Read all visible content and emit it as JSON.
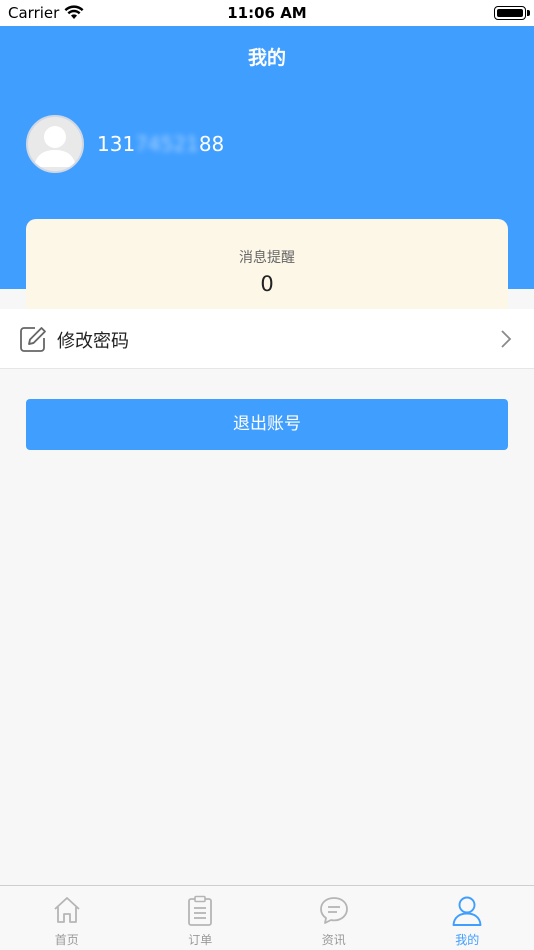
{
  "status_bar": {
    "carrier": "Carrier",
    "time": "11:06 AM"
  },
  "header": {
    "title": "我的"
  },
  "user": {
    "phone_prefix": "131",
    "phone_masked": "74521",
    "phone_suffix": "88"
  },
  "message_card": {
    "label": "消息提醒",
    "count": "0"
  },
  "menu": {
    "change_password": "修改密码"
  },
  "logout_label": "退出账号",
  "tabbar": {
    "items": [
      {
        "label": "首页",
        "icon": "home-icon"
      },
      {
        "label": "订单",
        "icon": "order-icon"
      },
      {
        "label": "资讯",
        "icon": "chat-bubble-icon"
      },
      {
        "label": "我的",
        "icon": "person-icon",
        "active": true
      }
    ]
  },
  "colors": {
    "primary": "#409eff",
    "card_bg": "#fdf7e8",
    "page_bg": "#f7f7f7"
  }
}
